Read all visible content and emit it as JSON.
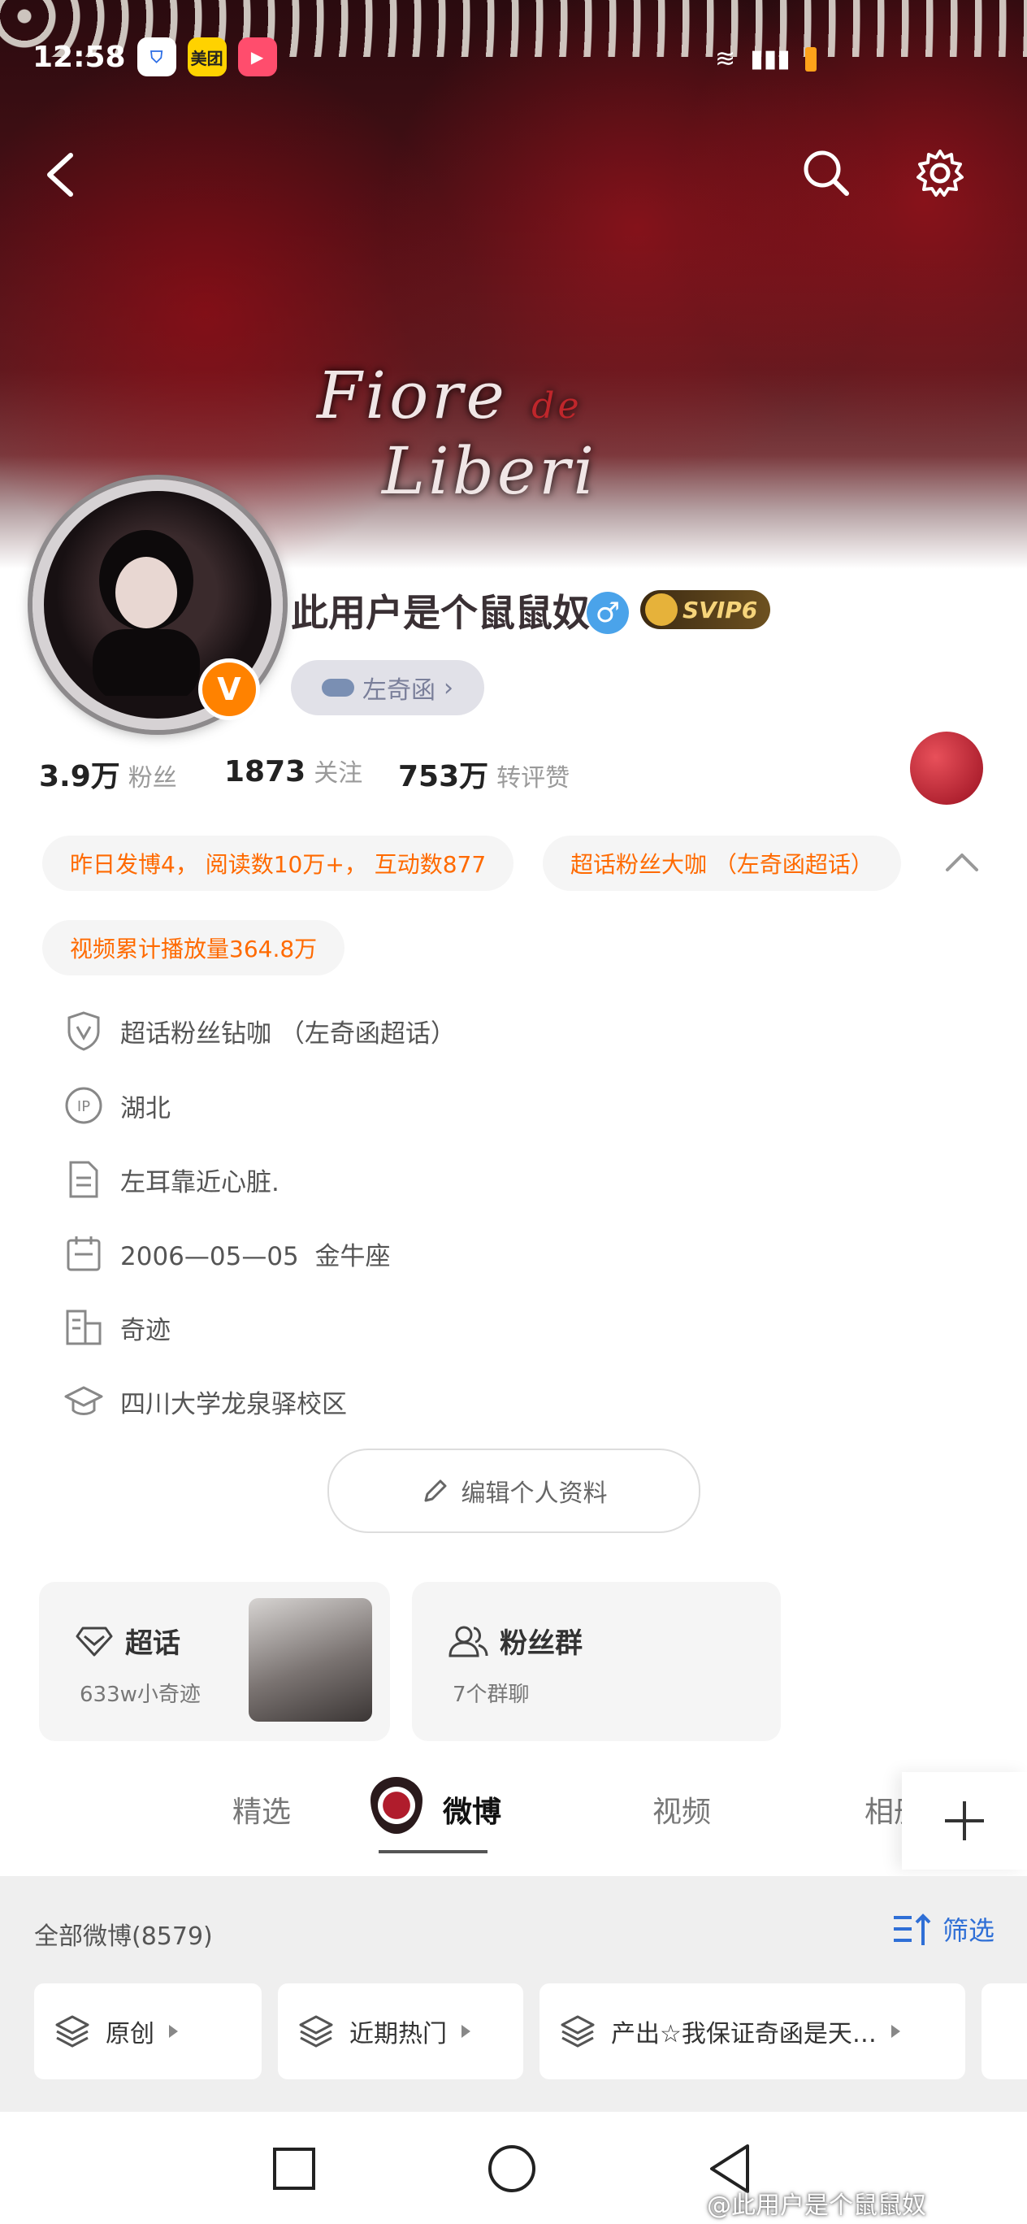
{
  "status_bar": {
    "time": "12:58",
    "icons": [
      "shield-icon",
      "meituan-icon",
      "video-app-icon"
    ],
    "meituan_label": "美团"
  },
  "banner": {
    "title_main": "Fiore",
    "title_de": "de",
    "title_sub": "Liberi"
  },
  "profile": {
    "username": "此用户是个鼠鼠奴",
    "gender_symbol": "♂",
    "vip_label": "SVIP6",
    "verified_symbol": "V",
    "tag_label": "左奇函",
    "tag_arrow": "›"
  },
  "stats": [
    {
      "value": "3.9万",
      "label": "粉丝"
    },
    {
      "value": "1873",
      "label": "关注"
    },
    {
      "value": "753万",
      "label": "转评赞"
    }
  ],
  "chips": [
    "昨日发博4， 阅读数10万+， 互动数877",
    "超话粉丝大咖 （左奇函超话）",
    "视频累计播放量364.8万"
  ],
  "info": [
    {
      "icon": "shield-v-icon",
      "text": "超话粉丝钻咖 （左奇函超话）"
    },
    {
      "icon": "ip-icon",
      "text": "湖北"
    },
    {
      "icon": "document-icon",
      "text": "左耳靠近心脏."
    },
    {
      "icon": "calendar-icon",
      "text": "2006—05—05  金牛座"
    },
    {
      "icon": "company-icon",
      "text": "奇迹"
    },
    {
      "icon": "graduation-cap-icon",
      "text": "四川大学龙泉驿校区"
    }
  ],
  "edit_button": "编辑个人资料",
  "cards": {
    "supertopic": {
      "title": "超话",
      "subtitle": "633w小奇迹"
    },
    "fangroup": {
      "title": "粉丝群",
      "subtitle": "7个群聊"
    }
  },
  "tabs": [
    "精选",
    "微博",
    "视频",
    "相册"
  ],
  "feed": {
    "all_label": "全部微博(8579)",
    "filter_label": "筛选"
  },
  "filters": [
    "原创",
    "近期热门",
    "产出☆我保证奇函是天…"
  ],
  "watermark": "@此用户是个鼠鼠奴",
  "colors": {
    "accent_orange": "#ff6a00",
    "vip_gold": "#f6d47a",
    "link_blue": "#2f6fd6"
  }
}
